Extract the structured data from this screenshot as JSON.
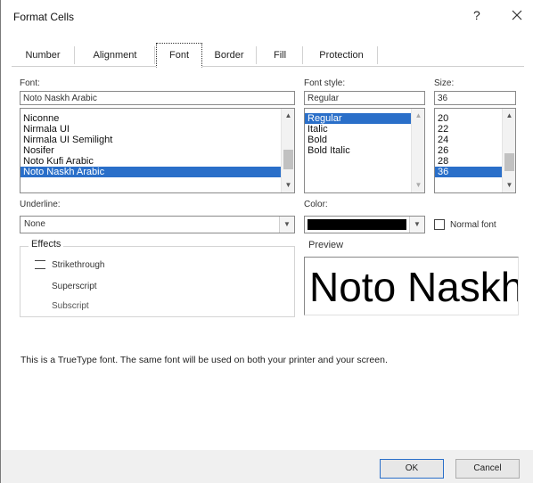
{
  "window": {
    "title": "Format Cells",
    "help_label": "?"
  },
  "tabs": [
    {
      "label": "Number"
    },
    {
      "label": "Alignment"
    },
    {
      "label": "Font",
      "active": true
    },
    {
      "label": "Border"
    },
    {
      "label": "Fill"
    },
    {
      "label": "Protection"
    }
  ],
  "font": {
    "label": "Font:",
    "value": "Noto Naskh Arabic",
    "items": [
      "Niconne",
      "Nirmala UI",
      "Nirmala UI Semilight",
      "Nosifer",
      "Noto Kufi Arabic",
      "Noto Naskh Arabic"
    ],
    "selected_index": 5
  },
  "font_style": {
    "label": "Font style:",
    "value": "Regular",
    "items": [
      "Regular",
      "Italic",
      "Bold",
      "Bold Italic"
    ],
    "selected_index": 0
  },
  "size": {
    "label": "Size:",
    "value": "36",
    "items": [
      "20",
      "22",
      "24",
      "26",
      "28",
      "36"
    ],
    "selected_index": 5
  },
  "underline": {
    "label": "Underline:",
    "value": "None"
  },
  "color": {
    "label": "Color:",
    "value": "#000000"
  },
  "normal_font": {
    "label": "Normal font"
  },
  "effects": {
    "title": "Effects",
    "strikethrough": "Strikethrough",
    "superscript": "Superscript",
    "subscript": "Subscript"
  },
  "preview": {
    "label": "Preview",
    "sample": "Noto Naskh Arabic"
  },
  "info": "This is a TrueType font.  The same font will be used on both your printer and your screen.",
  "buttons": {
    "ok": "OK",
    "cancel": "Cancel"
  },
  "colors": {
    "selection": "#2a6fc9",
    "footer": "#f0f0f0"
  }
}
